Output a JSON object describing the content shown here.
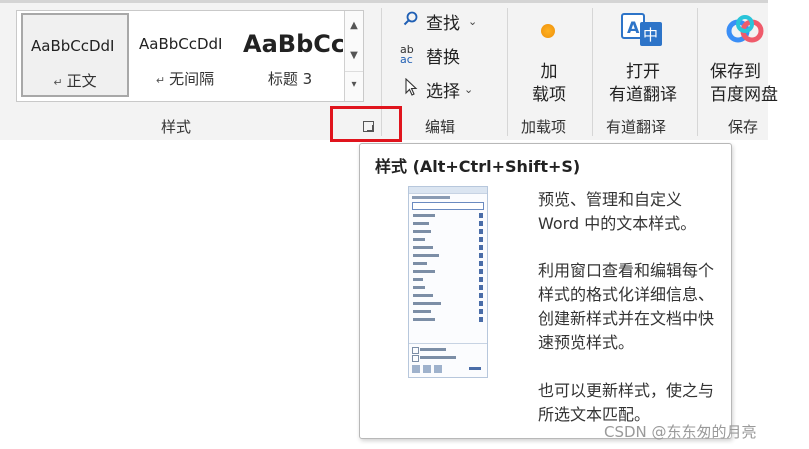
{
  "ribbon": {
    "styles_group": {
      "label": "样式",
      "items": [
        {
          "sample": "AaBbCcDdI",
          "name": "正文",
          "mark": "↵",
          "selected": true
        },
        {
          "sample": "AaBbCcDdI",
          "name": "无间隔",
          "mark": "↵",
          "selected": false
        },
        {
          "sample": "AaBbCc",
          "name": "标题 3",
          "mark": "",
          "selected": false
        }
      ],
      "scroll_up": "▲",
      "scroll_down": "▼",
      "more": "▾"
    },
    "editing_group": {
      "label": "编辑",
      "find": "查找",
      "replace": "替换",
      "select": "选择"
    },
    "addins_group": {
      "label": "加载项",
      "button_line1": "加",
      "button_line2": "载项"
    },
    "youdao_group": {
      "label": "有道翻译",
      "button_line1": "打开",
      "button_line2": "有道翻译"
    },
    "save_group": {
      "label": "保存",
      "button_line1": "保存到",
      "button_line2": "百度网盘"
    }
  },
  "tooltip": {
    "title": "样式 (Alt+Ctrl+Shift+S)",
    "para1": "预览、管理和自定义 Word 中的文本样式。",
    "para2": "利用窗口查看和编辑每个样式的格式化详细信息、创建新样式并在文档中快速预览样式。",
    "para3": "也可以更新样式，使之与所选文本匹配。"
  },
  "colors": {
    "highlight_box": "#e0141d",
    "ribbon_bg": "#f3f3f3",
    "accent_blue": "#1f5fb4"
  },
  "watermark": "CSDN @东东匆的月亮"
}
